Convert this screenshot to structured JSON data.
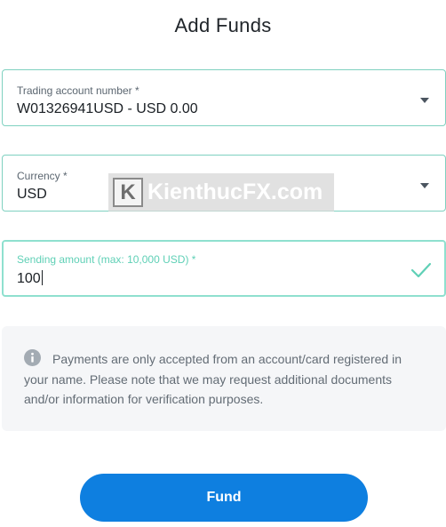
{
  "page": {
    "title": "Add Funds"
  },
  "trading_account": {
    "label": "Trading account number *",
    "value": "W01326941USD - USD 0.00"
  },
  "currency": {
    "label": "Currency *",
    "value": "USD"
  },
  "sending_amount": {
    "label": "Sending amount (max: 10,000 USD) *",
    "value": "100"
  },
  "watermark": {
    "letter": "K",
    "text": "KienthucFX.com"
  },
  "info": {
    "icon": "info-icon",
    "text": "Payments are only accepted from an account/card registered in your name. Please note that we may request additional documents and/or information for verification purposes."
  },
  "actions": {
    "fund_label": "Fund"
  },
  "colors": {
    "accent": "#0e7fe0",
    "field_border": "#7fd1c0",
    "valid_check": "#5fd0b6",
    "info_background": "#f5f6f8"
  }
}
